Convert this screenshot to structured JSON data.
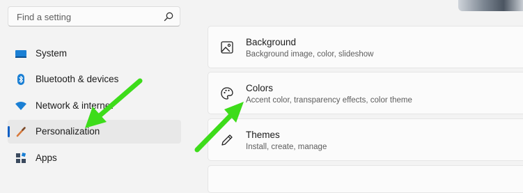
{
  "search": {
    "placeholder": "Find a setting",
    "icon": "search-icon"
  },
  "sidebar": {
    "items": [
      {
        "label": "System",
        "icon": "system-icon",
        "icon_color": "#0f6cbd"
      },
      {
        "label": "Bluetooth & devices",
        "icon": "bluetooth-icon",
        "icon_color": "#0f6cbd"
      },
      {
        "label": "Network & internet",
        "icon": "wifi-icon",
        "icon_color": "#0f6cbd"
      },
      {
        "label": "Personalization",
        "icon": "brush-icon",
        "icon_color": "#d87a3c",
        "selected": true
      },
      {
        "label": "Apps",
        "icon": "apps-icon",
        "icon_color": "#3b4a5e"
      }
    ]
  },
  "cards": [
    {
      "title": "Background",
      "subtitle": "Background image, color, slideshow",
      "icon": "image-icon"
    },
    {
      "title": "Colors",
      "subtitle": "Accent color, transparency effects, color theme",
      "icon": "palette-icon"
    },
    {
      "title": "Themes",
      "subtitle": "Install, create, manage",
      "icon": "pen-icon"
    }
  ],
  "colors": {
    "accent": "#0f5fc4",
    "annotation_arrow": "#3ddc1a",
    "selected_bg": "#e8e8e8"
  }
}
